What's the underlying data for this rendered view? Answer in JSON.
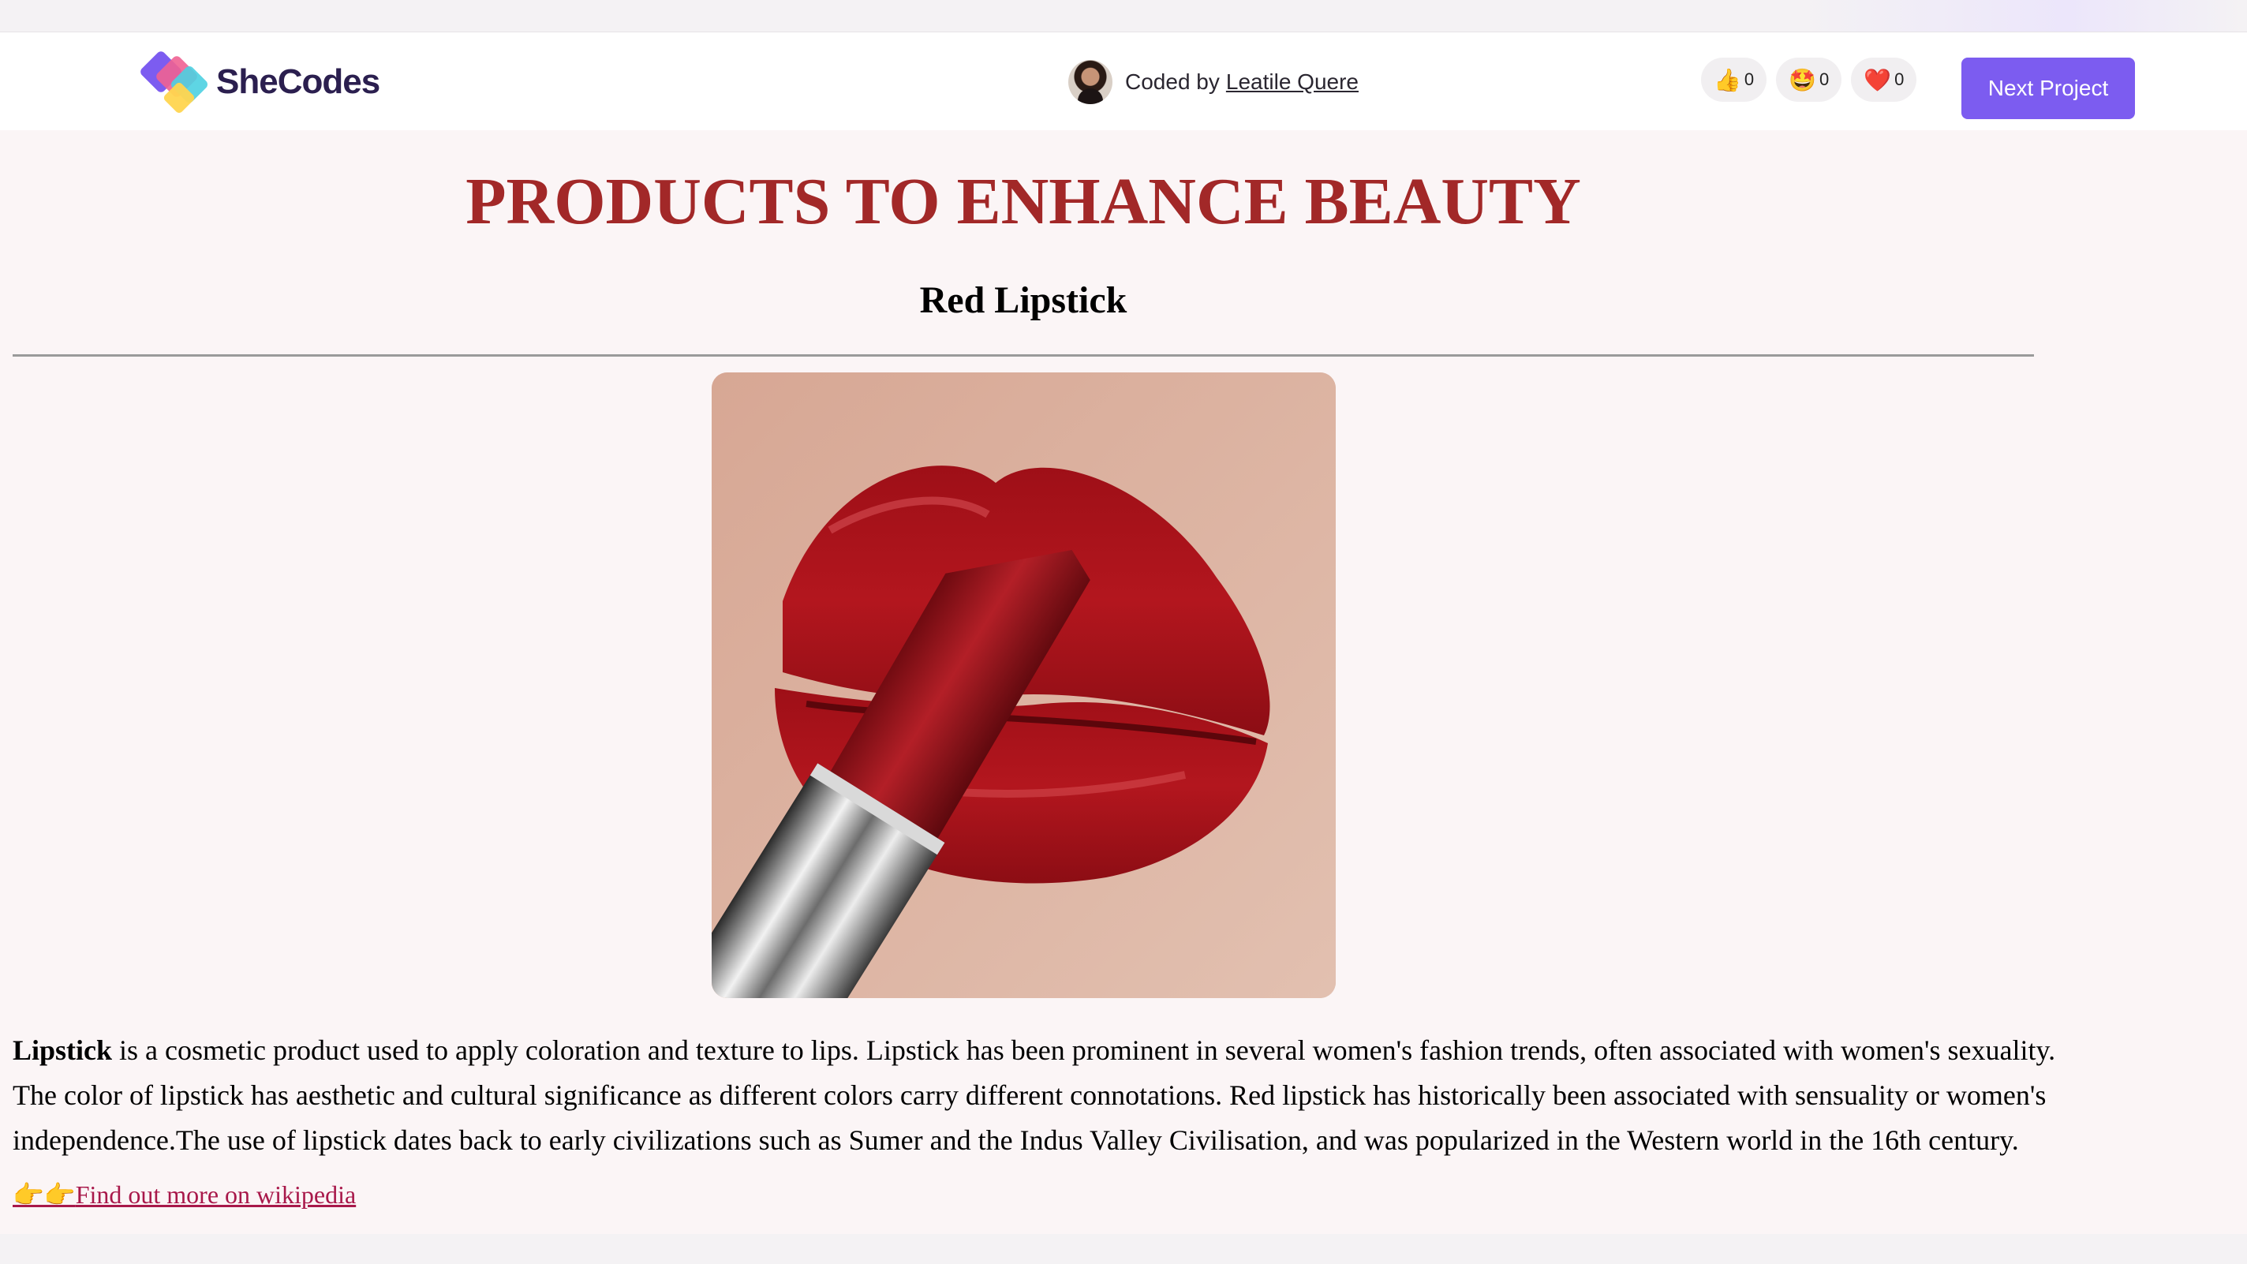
{
  "header": {
    "brand": "SheCodes",
    "coded_by_prefix": "Coded by",
    "author": "Leatile Quere",
    "reactions": [
      {
        "icon": "👍",
        "count": "0"
      },
      {
        "icon": "🤩",
        "count": "0"
      },
      {
        "icon": "❤️",
        "count": "0"
      }
    ],
    "next_button": "Next Project"
  },
  "main": {
    "title": "PRODUCTS TO ENHANCE BEAUTY",
    "subtitle": "Red Lipstick",
    "paragraph_bold": "Lipstick",
    "paragraph_rest": " is a cosmetic product used to apply coloration and texture to lips. Lipstick has been prominent in several women's fashion trends, often associated with women's sexuality. The color of lipstick has aesthetic and cultural significance as different colors carry different connotations. Red lipstick has historically been associated with sensuality or women's independence.The use of lipstick dates back to early civilizations such as Sumer and the Indus Valley Civilisation, and was popularized in the Western world in the 16th century.",
    "link_emoji": "👉👉",
    "link_text": "Find out more on wikipedia"
  },
  "colors": {
    "title": "#a22828",
    "button": "#7c5cf0",
    "link": "#a8184a",
    "background": "#fbf5f6"
  }
}
